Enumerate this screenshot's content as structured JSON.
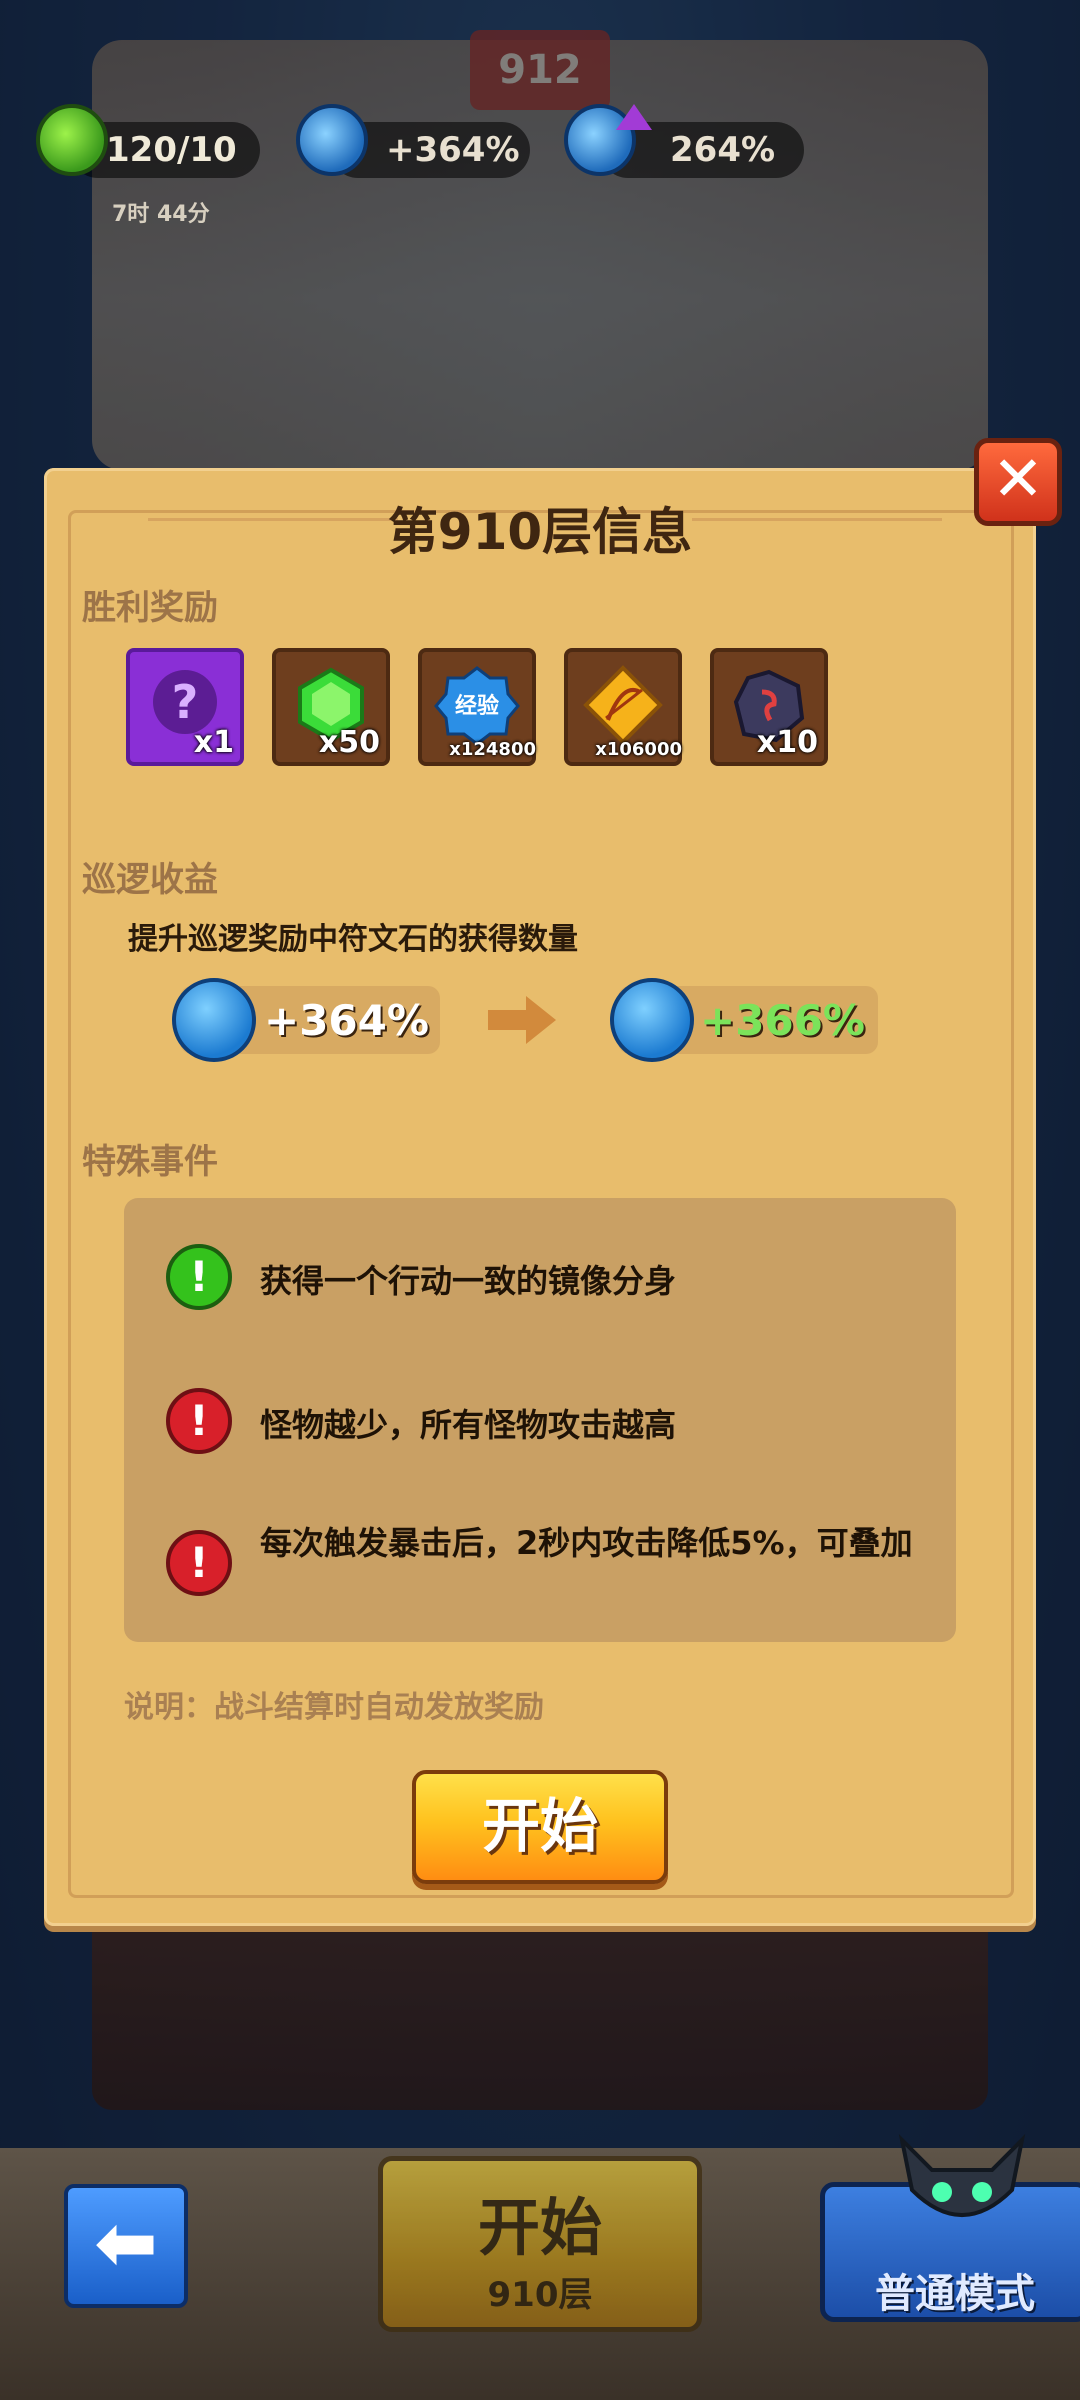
{
  "hud": {
    "potion": {
      "value": "120/10",
      "timer": "7时 44分",
      "icon": "green-potion-icon"
    },
    "patrol_bonus": {
      "value": "+364%",
      "icon": "blue-clock-icon"
    },
    "rune_bonus": {
      "value": "264%",
      "icon": "blue-rune-icon"
    }
  },
  "world": {
    "floor_banner": "912"
  },
  "panel": {
    "title": "第910层信息",
    "close_icon": "close-x-icon",
    "victory_rewards_label": "胜利奖励",
    "rewards": [
      {
        "icon": "mystery-purple-icon",
        "count": "x1"
      },
      {
        "icon": "green-gem-icon",
        "count": "x50"
      },
      {
        "icon": "exp-badge-icon",
        "label": "经验",
        "count": "x124800"
      },
      {
        "icon": "golden-bow-icon",
        "count": "x106000"
      },
      {
        "icon": "dark-rune-stone-icon",
        "count": "x10"
      }
    ],
    "patrol_label": "巡逻收益",
    "patrol_desc": "提升巡逻奖励中符文石的获得数量",
    "patrol_current": "+364%",
    "patrol_next": "+366%",
    "special_label": "特殊事件",
    "events": [
      {
        "type": "positive",
        "text": "获得一个行动一致的镜像分身"
      },
      {
        "type": "negative",
        "text": "怪物越少，所有怪物攻击越高"
      },
      {
        "type": "negative",
        "text": "每次触发暴击后，2秒内攻击降低5%，可叠加"
      }
    ],
    "note": "说明：战斗结算时自动发放奖励",
    "start_label": "开始"
  },
  "bottom": {
    "back_icon": "back-arrow-icon",
    "start_label": "开始",
    "floor_label": "910层",
    "mode_label": "普通模式"
  },
  "colors": {
    "panel": "#e8bd6c",
    "positive": "#34c21c",
    "negative": "#d8202a",
    "next_value": "#7be35a"
  }
}
